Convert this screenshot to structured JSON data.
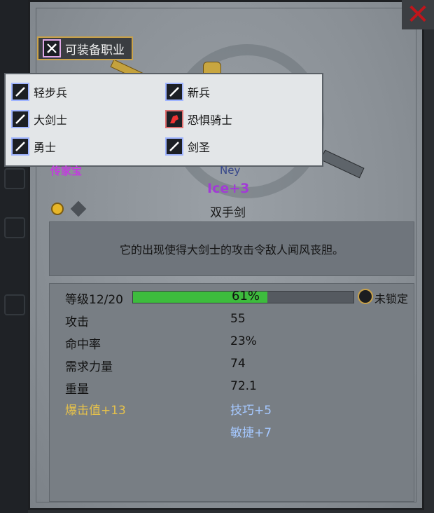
{
  "close_symbol": "✕",
  "equippable_badge": {
    "label": "可装备职业",
    "icon": "sword-class-icon"
  },
  "popup": {
    "jobs": [
      {
        "label": "轻步兵",
        "icon": "sword-icon",
        "col": 0,
        "row": 0
      },
      {
        "label": "新兵",
        "icon": "sword-icon",
        "col": 1,
        "row": 0
      },
      {
        "label": "大剑士",
        "icon": "sword-icon",
        "col": 0,
        "row": 1
      },
      {
        "label": "恐惧骑士",
        "icon": "horse-icon",
        "col": 1,
        "row": 1
      },
      {
        "label": "勇士",
        "icon": "sword-icon",
        "col": 0,
        "row": 2
      },
      {
        "label": "剑圣",
        "icon": "sword-icon",
        "col": 1,
        "row": 2
      }
    ]
  },
  "item": {
    "rarity": "传家宝",
    "maker": "Ney",
    "enhancement": "Ice+3",
    "type": "双手剑",
    "description": "它的出现使得大剑士的攻击令敌人闻风丧胆。",
    "gems": [
      "gold-gem-icon",
      "empty-gem-slot-icon"
    ]
  },
  "stats": {
    "level_label": "等级12/20",
    "xp_percent_text": "61%",
    "xp_fraction": 0.61,
    "lock_label": "未锁定",
    "rows": [
      {
        "name": "攻击",
        "value": "55"
      },
      {
        "name": "命中率",
        "value": "23%"
      },
      {
        "name": "需求力量",
        "value": "74"
      },
      {
        "name": "重量",
        "value": "72.1"
      }
    ],
    "bonuses_left": [
      "爆击值+13"
    ],
    "bonuses_right": [
      "技巧+5",
      "敏捷+7"
    ]
  },
  "colors": {
    "rarity": "#c33ae0",
    "enhancement": "#a23bd6",
    "xp_fill": "#3dbc3d",
    "gold_bonus": "#e7c24a",
    "blue_bonus": "#a5c8ff",
    "close": "#c0151b"
  }
}
